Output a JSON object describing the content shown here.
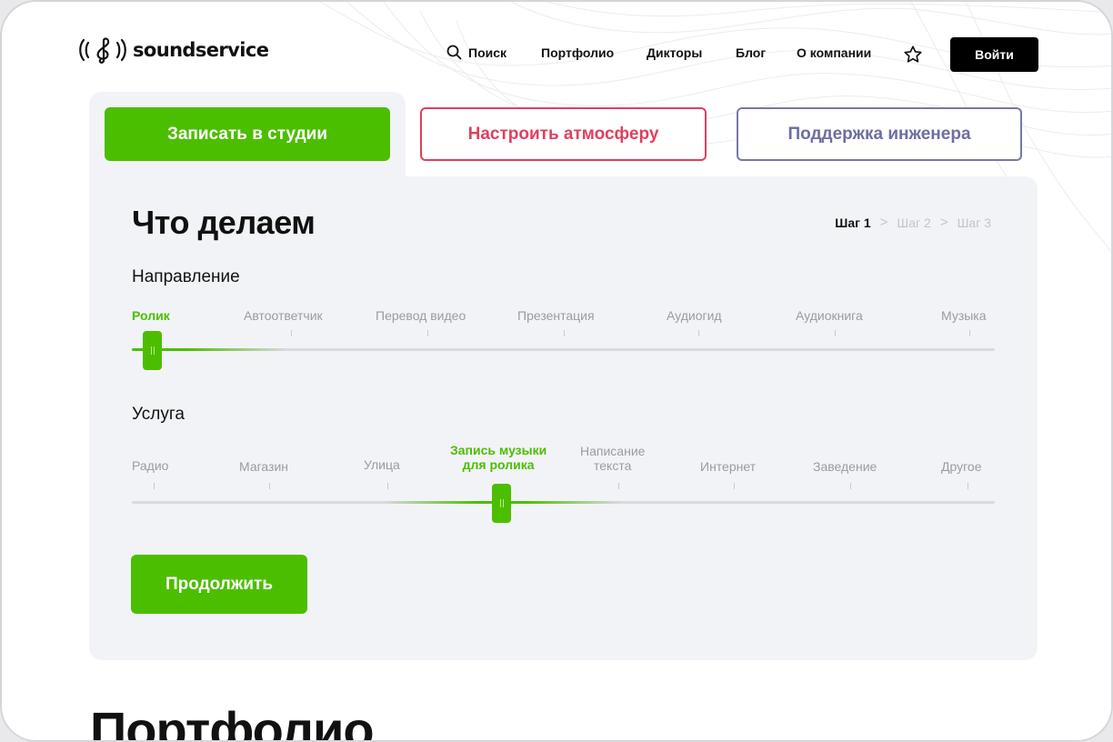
{
  "header": {
    "logo_text": "soundservice",
    "search_label": "Поиск",
    "nav": [
      "Портфолио",
      "Дикторы",
      "Блог",
      "О компании"
    ],
    "login_label": "Войти",
    "icons": {
      "search": "search-icon",
      "favorites": "star-icon",
      "logo": "treble-clef-icon"
    }
  },
  "tabs": {
    "studio": "Записать в студии",
    "atmosphere": "Настроить атмосферу",
    "engineer": "Поддержка инженера"
  },
  "panel": {
    "title": "Что делаем",
    "steps": [
      "Шаг 1",
      "Шаг 2",
      "Шаг 3"
    ],
    "active_step": 1
  },
  "direction": {
    "label": "Направление",
    "options": [
      "Ролик",
      "Автоответчик",
      "Перевод видео",
      "Презентация",
      "Аудиогид",
      "Аудиокнига",
      "Музыка"
    ],
    "selected_index": 0
  },
  "service": {
    "label": "Услуга",
    "options": [
      "Радио",
      "Магазин",
      "Улица",
      "Запись музыки\nдля ролика",
      "Написание\nтекста",
      "Интернет",
      "Заведение",
      "Другое"
    ],
    "selected_index": 3
  },
  "continue_label": "Продолжить",
  "portfolio_title": "Портфолио",
  "colors": {
    "accent_green": "#4cbe00",
    "atmosphere_red": "#e0405e",
    "engineer_purple": "#6d6ea3",
    "panel_bg": "#f2f3f6"
  }
}
